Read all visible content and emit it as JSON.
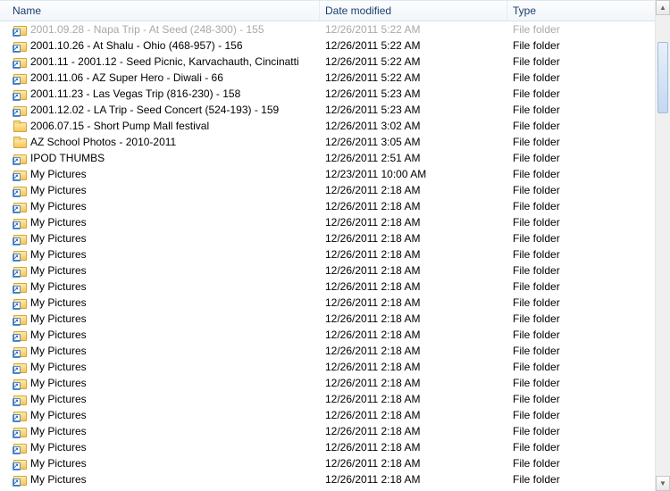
{
  "columns": {
    "name": "Name",
    "date": "Date modified",
    "type": "Type"
  },
  "type_label": "File folder",
  "rows": [
    {
      "name": "2001.09.28 - Napa Trip - At Seed (248-300) - 155",
      "date": "12/26/2011 5:22 AM",
      "icon": "folder-shortcut",
      "dim": true
    },
    {
      "name": "2001.10.26 - At Shalu - Ohio (468-957) - 156",
      "date": "12/26/2011 5:22 AM",
      "icon": "folder-shortcut",
      "dim": false
    },
    {
      "name": "2001.11 - 2001.12 - Seed Picnic, Karvachauth, Cincinatti",
      "date": "12/26/2011 5:22 AM",
      "icon": "folder-shortcut",
      "dim": false
    },
    {
      "name": "2001.11.06 - AZ Super Hero - Diwali - 66",
      "date": "12/26/2011 5:22 AM",
      "icon": "folder-shortcut",
      "dim": false
    },
    {
      "name": "2001.11.23 - Las Vegas Trip (816-230) - 158",
      "date": "12/26/2011 5:23 AM",
      "icon": "folder-shortcut",
      "dim": false
    },
    {
      "name": "2001.12.02 - LA Trip - Seed Concert (524-193) - 159",
      "date": "12/26/2011 5:23 AM",
      "icon": "folder-shortcut",
      "dim": false
    },
    {
      "name": "2006.07.15 - Short Pump Mall festival",
      "date": "12/26/2011 3:02 AM",
      "icon": "folder-yellow",
      "dim": false
    },
    {
      "name": "AZ School Photos - 2010-2011",
      "date": "12/26/2011 3:05 AM",
      "icon": "folder-yellow",
      "dim": false
    },
    {
      "name": "IPOD THUMBS",
      "date": "12/26/2011 2:51 AM",
      "icon": "folder-shortcut",
      "dim": false
    },
    {
      "name": "My Pictures",
      "date": "12/23/2011 10:00 AM",
      "icon": "folder-shortcut",
      "dim": false
    },
    {
      "name": "My Pictures",
      "date": "12/26/2011 2:18 AM",
      "icon": "folder-shortcut",
      "dim": false
    },
    {
      "name": "My Pictures",
      "date": "12/26/2011 2:18 AM",
      "icon": "folder-shortcut",
      "dim": false
    },
    {
      "name": "My Pictures",
      "date": "12/26/2011 2:18 AM",
      "icon": "folder-shortcut",
      "dim": false
    },
    {
      "name": "My Pictures",
      "date": "12/26/2011 2:18 AM",
      "icon": "folder-shortcut",
      "dim": false
    },
    {
      "name": "My Pictures",
      "date": "12/26/2011 2:18 AM",
      "icon": "folder-shortcut",
      "dim": false
    },
    {
      "name": "My Pictures",
      "date": "12/26/2011 2:18 AM",
      "icon": "folder-shortcut",
      "dim": false
    },
    {
      "name": "My Pictures",
      "date": "12/26/2011 2:18 AM",
      "icon": "folder-shortcut",
      "dim": false
    },
    {
      "name": "My Pictures",
      "date": "12/26/2011 2:18 AM",
      "icon": "folder-shortcut",
      "dim": false
    },
    {
      "name": "My Pictures",
      "date": "12/26/2011 2:18 AM",
      "icon": "folder-shortcut",
      "dim": false
    },
    {
      "name": "My Pictures",
      "date": "12/26/2011 2:18 AM",
      "icon": "folder-shortcut",
      "dim": false
    },
    {
      "name": "My Pictures",
      "date": "12/26/2011 2:18 AM",
      "icon": "folder-shortcut",
      "dim": false
    },
    {
      "name": "My Pictures",
      "date": "12/26/2011 2:18 AM",
      "icon": "folder-shortcut",
      "dim": false
    },
    {
      "name": "My Pictures",
      "date": "12/26/2011 2:18 AM",
      "icon": "folder-shortcut",
      "dim": false
    },
    {
      "name": "My Pictures",
      "date": "12/26/2011 2:18 AM",
      "icon": "folder-shortcut",
      "dim": false
    },
    {
      "name": "My Pictures",
      "date": "12/26/2011 2:18 AM",
      "icon": "folder-shortcut",
      "dim": false
    },
    {
      "name": "My Pictures",
      "date": "12/26/2011 2:18 AM",
      "icon": "folder-shortcut",
      "dim": false
    },
    {
      "name": "My Pictures",
      "date": "12/26/2011 2:18 AM",
      "icon": "folder-shortcut",
      "dim": false
    },
    {
      "name": "My Pictures",
      "date": "12/26/2011 2:18 AM",
      "icon": "folder-shortcut",
      "dim": false
    },
    {
      "name": "My Pictures",
      "date": "12/26/2011 2:18 AM",
      "icon": "folder-shortcut",
      "dim": false
    }
  ]
}
